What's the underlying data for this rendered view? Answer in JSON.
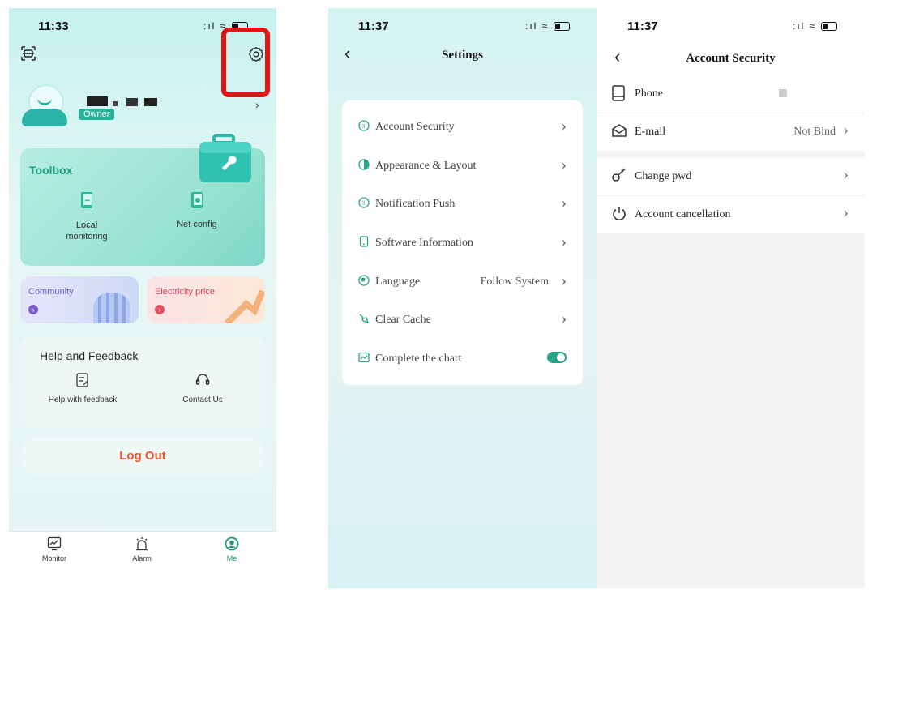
{
  "me_screen": {
    "status_time": "11:33",
    "user_role_badge": "Owner",
    "toolbox": {
      "title": "Toolbox",
      "items": [
        {
          "label": "Local monitoring",
          "icon": "phone-wifi-icon"
        },
        {
          "label": "Net config",
          "icon": "phone-globe-icon"
        }
      ]
    },
    "banners": [
      {
        "label": "Community",
        "color": "#7b5fc6"
      },
      {
        "label": "Electricity price",
        "color": "#e0505f"
      }
    ],
    "help": {
      "title": "Help and Feedback",
      "items": [
        {
          "label": "Help with feedback",
          "icon": "edit-note-icon"
        },
        {
          "label": "Contact Us",
          "icon": "headset-icon"
        }
      ]
    },
    "logout_label": "Log Out",
    "tabs": [
      {
        "label": "Monitor",
        "icon": "monitor-icon",
        "active": false
      },
      {
        "label": "Alarm",
        "icon": "alarm-bell-icon",
        "active": false
      },
      {
        "label": "Me",
        "icon": "user-circle-icon",
        "active": true
      }
    ],
    "accent_color": "#2bb596",
    "logout_color": "#e8552f",
    "highlight_color": "#e01515"
  },
  "settings_screen": {
    "status_time": "11:37",
    "title": "Settings",
    "items": [
      {
        "label": "Account Security",
        "value": ""
      },
      {
        "label": "Appearance & Layout",
        "value": ""
      },
      {
        "label": "Notification Push",
        "value": ""
      },
      {
        "label": "Software Information",
        "value": ""
      },
      {
        "label": "Language",
        "value": "Follow System"
      },
      {
        "label": "Clear Cache",
        "value": ""
      },
      {
        "label": "Complete the chart",
        "value": "",
        "toggle": true
      }
    ],
    "toggle_color": "#2ba587"
  },
  "account_security_screen": {
    "status_time": "11:37",
    "title": "Account Security",
    "group1": [
      {
        "label": "Phone",
        "value": "",
        "icon": "phone-icon"
      },
      {
        "label": "E-mail",
        "value": "Not Bind",
        "icon": "mail-icon"
      }
    ],
    "group2": [
      {
        "label": "Change pwd",
        "icon": "key-icon"
      },
      {
        "label": "Account cancellation",
        "icon": "power-icon"
      }
    ]
  }
}
